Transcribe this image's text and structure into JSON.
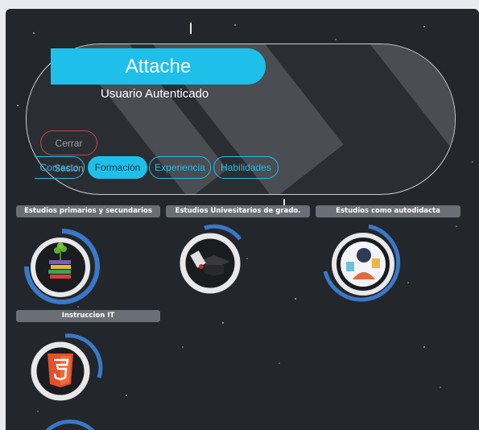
{
  "hero": {
    "title": "Attache",
    "subtitle": "Usuario Autenticado",
    "logout_label": "Cerrar Sesion"
  },
  "tabs": [
    {
      "label": "Contacto"
    },
    {
      "label": "Formación",
      "active": true
    },
    {
      "label": "Experiencia"
    },
    {
      "label": "Habilidades"
    }
  ],
  "sections": [
    {
      "label": "Estudios primarios y secundarios",
      "icon": "books-plant-icon"
    },
    {
      "label": "Estudios Univesitarios de grado.",
      "icon": "graduation-cap-icon"
    },
    {
      "label": "Estudios como autodidacta",
      "icon": "self-study-icon"
    },
    {
      "label": "Instruccion IT",
      "icon": "html5-icon"
    }
  ],
  "colors": {
    "accent": "#1ec0ea",
    "ring": "#3a78c9",
    "logout_border": "#c2474b"
  }
}
